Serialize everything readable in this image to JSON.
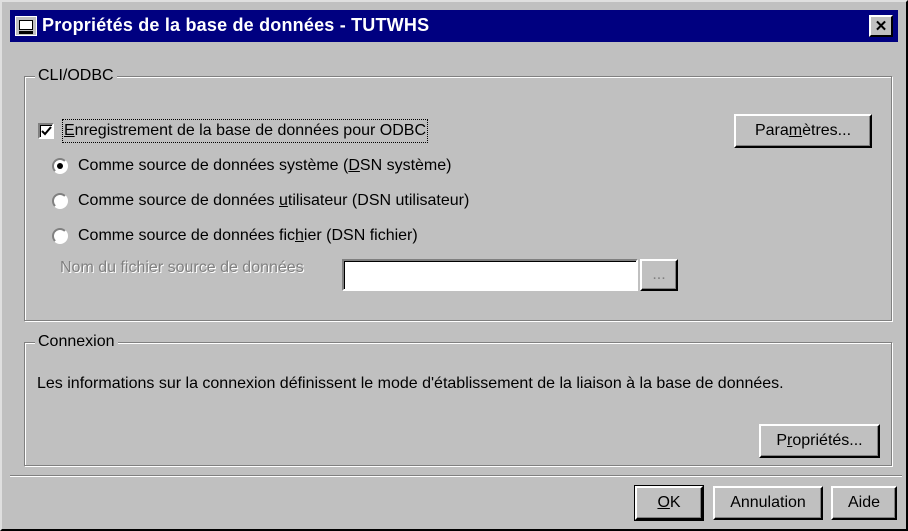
{
  "window": {
    "title": "Propriétés de la base de données - TUTWHS",
    "close_label": "✕"
  },
  "cli_odbc": {
    "group_label": "CLI/ODBC",
    "register_checkbox": {
      "checked": true,
      "label_pre": "",
      "mnemonic": "E",
      "label_post": "nregistrement de la base de données pour ODBC"
    },
    "parameters_button": {
      "pre": "Para",
      "mnemonic": "m",
      "post": "ètres..."
    },
    "radio_system": {
      "selected": true,
      "pre": "Comme source de données système (",
      "mnemonic": "D",
      "post": "SN système)"
    },
    "radio_user": {
      "selected": false,
      "pre": "Comme source de données ",
      "mnemonic": "u",
      "post": "tilisateur (DSN utilisateur)"
    },
    "radio_file": {
      "selected": false,
      "pre": "Comme source de données fic",
      "mnemonic": "h",
      "post": "ier (DSN fichier)"
    },
    "file_name_label": "Nom du fichier source de données",
    "file_name_value": "",
    "browse_label": "..."
  },
  "connection": {
    "group_label": "Connexion",
    "description": "Les informations sur la connexion définissent le mode d'établissement de la liaison à la base de données.",
    "properties_button": {
      "pre": "P",
      "mnemonic": "r",
      "post": "opriétés..."
    }
  },
  "footer": {
    "ok": {
      "mnemonic": "O",
      "post": "K"
    },
    "cancel_label": "Annulation",
    "help_label": "Aide"
  }
}
